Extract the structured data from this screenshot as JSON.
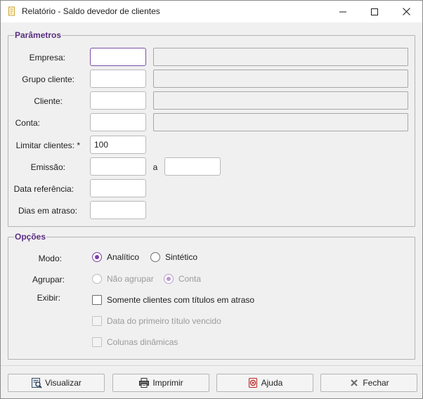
{
  "window": {
    "title": "Relatório - Saldo devedor de clientes"
  },
  "params": {
    "legend": "Parâmetros",
    "empresa_label": "Empresa:",
    "grupo_label": "Grupo cliente:",
    "cliente_label": "Cliente:",
    "conta_label": "Conta:",
    "limitar_label": "Limitar clientes: *",
    "limitar_value": "100",
    "emissao_label": "Emissão:",
    "emissao_sep": "a",
    "data_ref_label": "Data referência:",
    "dias_label": "Dias em atraso:"
  },
  "options": {
    "legend": "Opções",
    "modo_label": "Modo:",
    "modo_options": [
      "Analítico",
      "Sintético"
    ],
    "modo_selected": "Analítico",
    "agrupar_label": "Agrupar:",
    "agrupar_options": [
      "Não agrupar",
      "Conta"
    ],
    "agrupar_selected": "Conta",
    "exibir_label": "Exibir:",
    "exibir_items": [
      "Somente clientes com títulos em atraso",
      "Data do primeiro título vencido",
      "Colunas dinâmicas"
    ]
  },
  "buttons": {
    "visualizar": "Visualizar",
    "imprimir": "Imprimir",
    "ajuda": "Ajuda",
    "fechar": "Fechar"
  },
  "colors": {
    "accent": "#7b3fa8",
    "legend": "#5a2d82"
  }
}
